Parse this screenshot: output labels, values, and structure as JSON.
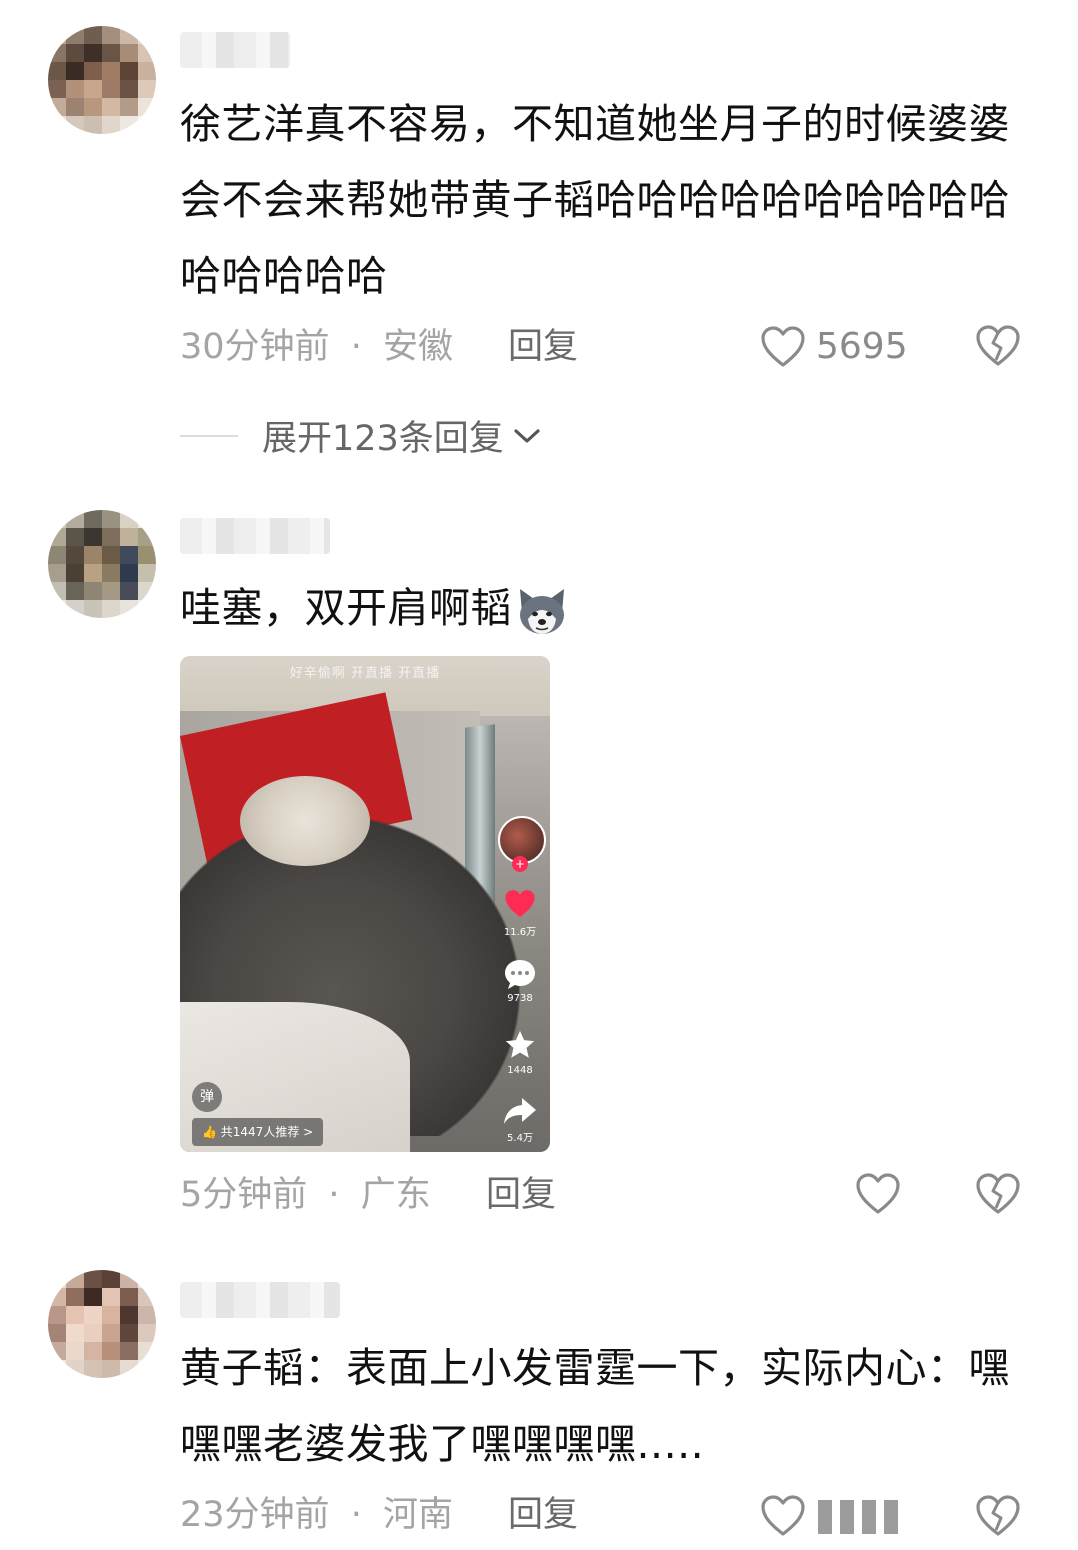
{
  "comments": [
    {
      "text": "徐艺洋真不容易，不知道她坐月子的时候婆婆会不会来帮她带黄子韬哈哈哈哈哈哈哈哈哈哈哈哈哈哈哈",
      "time": "30分钟前",
      "sep": "·",
      "location": "安徽",
      "reply_label": "回复",
      "like_count": "5695",
      "expand_label": "展开123条回复"
    },
    {
      "text": "哇塞，双开肩啊韬",
      "time": "5分钟前",
      "sep": "·",
      "location": "广东",
      "reply_label": "回复",
      "like_count": "",
      "video": {
        "overlay_top": "好辛偷啊      开直播      开直播",
        "likes": "11.6万",
        "comments": "9738",
        "favorites": "1448",
        "shares": "5.4万",
        "danmu": "弹",
        "recommend": "共1447人推荐 >"
      }
    },
    {
      "text": "黄子韬：表面上小发雷霆一下，实际内心：嘿嘿嘿老婆发我了嘿嘿嘿嘿.....",
      "time": "23分钟前",
      "sep": "·",
      "location": "河南",
      "reply_label": "回复",
      "like_count": ""
    }
  ],
  "icons": {
    "like": "heart-outline-icon",
    "dislike": "broken-heart-icon",
    "expand": "chevron-down-icon",
    "emoji": "husky-dog-emoji"
  }
}
